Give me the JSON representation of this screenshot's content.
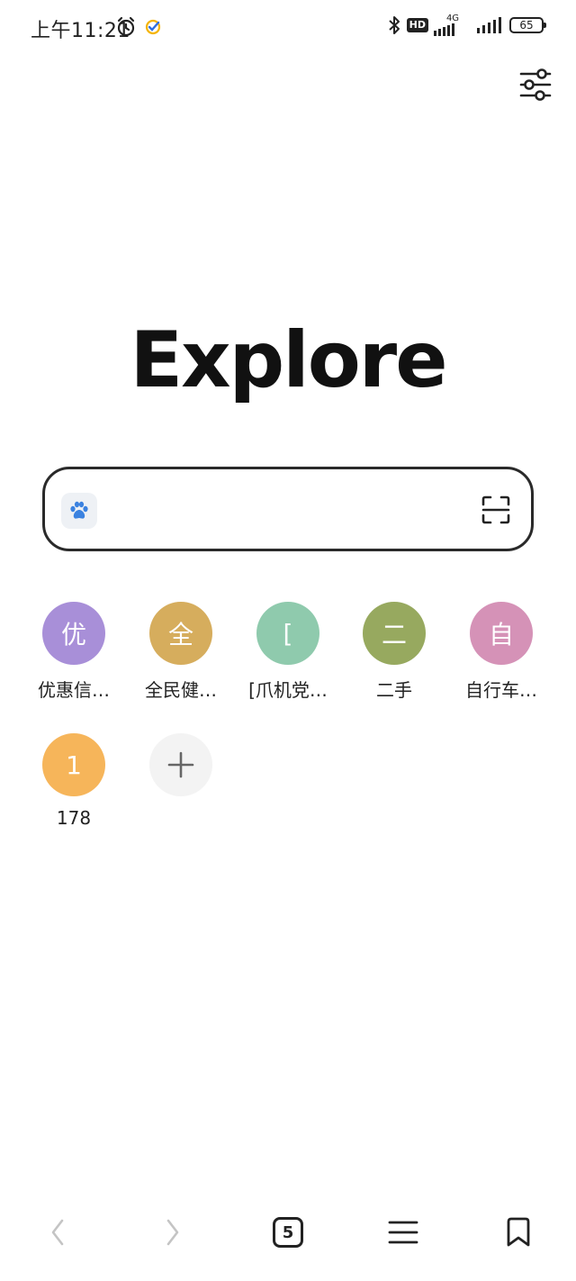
{
  "status_bar": {
    "time": "上午11:21",
    "network": "4G",
    "hd": "HD",
    "battery": "65"
  },
  "logo": {
    "text_before": "Expl",
    "text_o": "o",
    "text_after": "re"
  },
  "search": {
    "value": "",
    "placeholder": ""
  },
  "shortcuts": [
    {
      "initial": "优",
      "label": "优惠信…",
      "color": "#a88fd8"
    },
    {
      "initial": "全",
      "label": "全民健…",
      "color": "#d6ad5d"
    },
    {
      "initial": "[",
      "label": "[爪机党…",
      "color": "#8fcaad"
    },
    {
      "initial": "二",
      "label": "二手",
      "color": "#97a95f"
    },
    {
      "initial": "自",
      "label": "自行车…",
      "color": "#d592b7"
    },
    {
      "initial": "1",
      "label": "178",
      "color": "#f6b55a"
    }
  ],
  "bottom_nav": {
    "tab_count": "5"
  },
  "colors": {
    "accent_blue": "#4a90e2",
    "text": "#222222"
  }
}
